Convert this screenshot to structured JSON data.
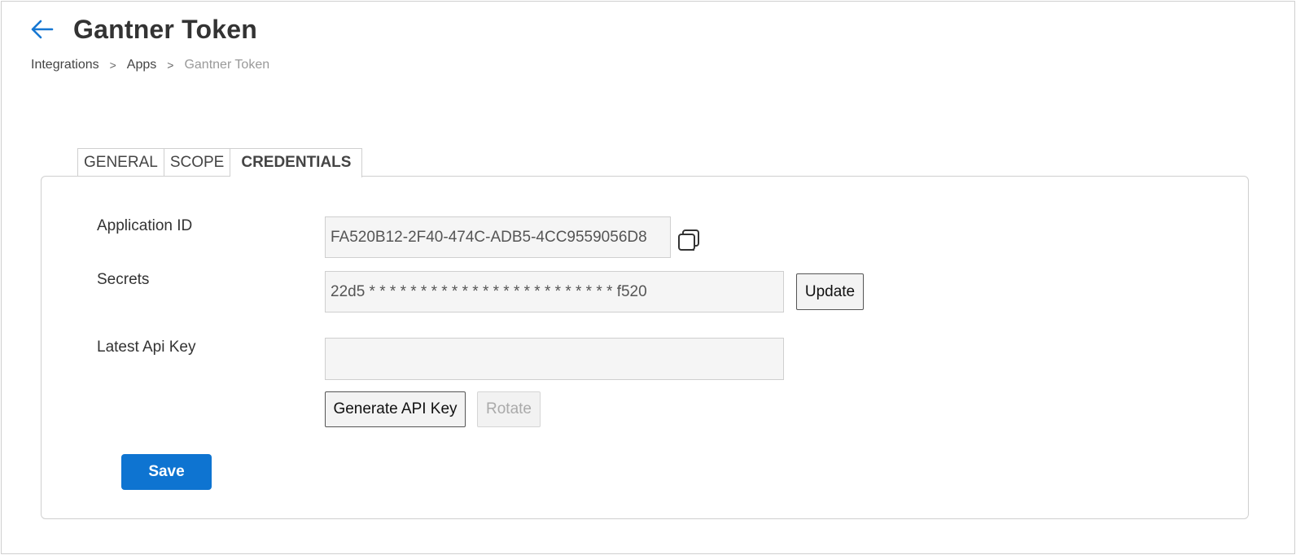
{
  "header": {
    "title": "Gantner Token",
    "back_icon": "arrow-left-icon",
    "accent_color": "#0e74d1"
  },
  "breadcrumb": {
    "items": [
      "Integrations",
      "Apps",
      "Gantner Token"
    ],
    "separator": ">"
  },
  "tabs": [
    {
      "label": "GENERAL",
      "active": false
    },
    {
      "label": "SCOPE",
      "active": false
    },
    {
      "label": "CREDENTIALS",
      "active": true
    }
  ],
  "credentials": {
    "application_id": {
      "label": "Application ID",
      "value": "FA520B12-2F40-474C-ADB5-4CC9559056D8",
      "copy_icon": "copy-icon"
    },
    "secrets": {
      "label": "Secrets",
      "value": "22d5 * * * * * * * * * * * * * * * * * * * * * * * * f520",
      "update_label": "Update"
    },
    "latest_api_key": {
      "label": "Latest Api Key",
      "value": "",
      "generate_label": "Generate API Key",
      "rotate_label": "Rotate",
      "rotate_disabled": true
    }
  },
  "actions": {
    "save_label": "Save"
  }
}
